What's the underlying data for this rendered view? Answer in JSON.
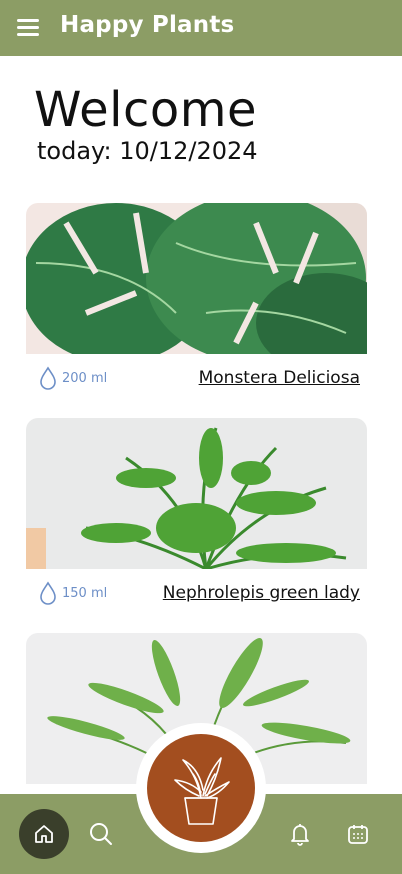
{
  "header": {
    "title": "Happy Plants"
  },
  "main": {
    "welcome": "Welcome",
    "today": "today: 10/12/2024"
  },
  "plants": [
    {
      "name": "Monstera Deliciosa",
      "water": "200 ml"
    },
    {
      "name": "Nephrolepis green lady",
      "water": "150 ml"
    },
    {
      "name": "",
      "water": ""
    }
  ],
  "bottom_nav": {
    "items": [
      "home-icon",
      "search-icon",
      "add-plant-icon",
      "bell-icon",
      "calendar-icon"
    ],
    "active": "home-icon"
  },
  "colors": {
    "brand": "#8c9d65",
    "accent": "#a34e1f",
    "active_nav": "#3a3f2b",
    "water": "#6d8fc7"
  }
}
